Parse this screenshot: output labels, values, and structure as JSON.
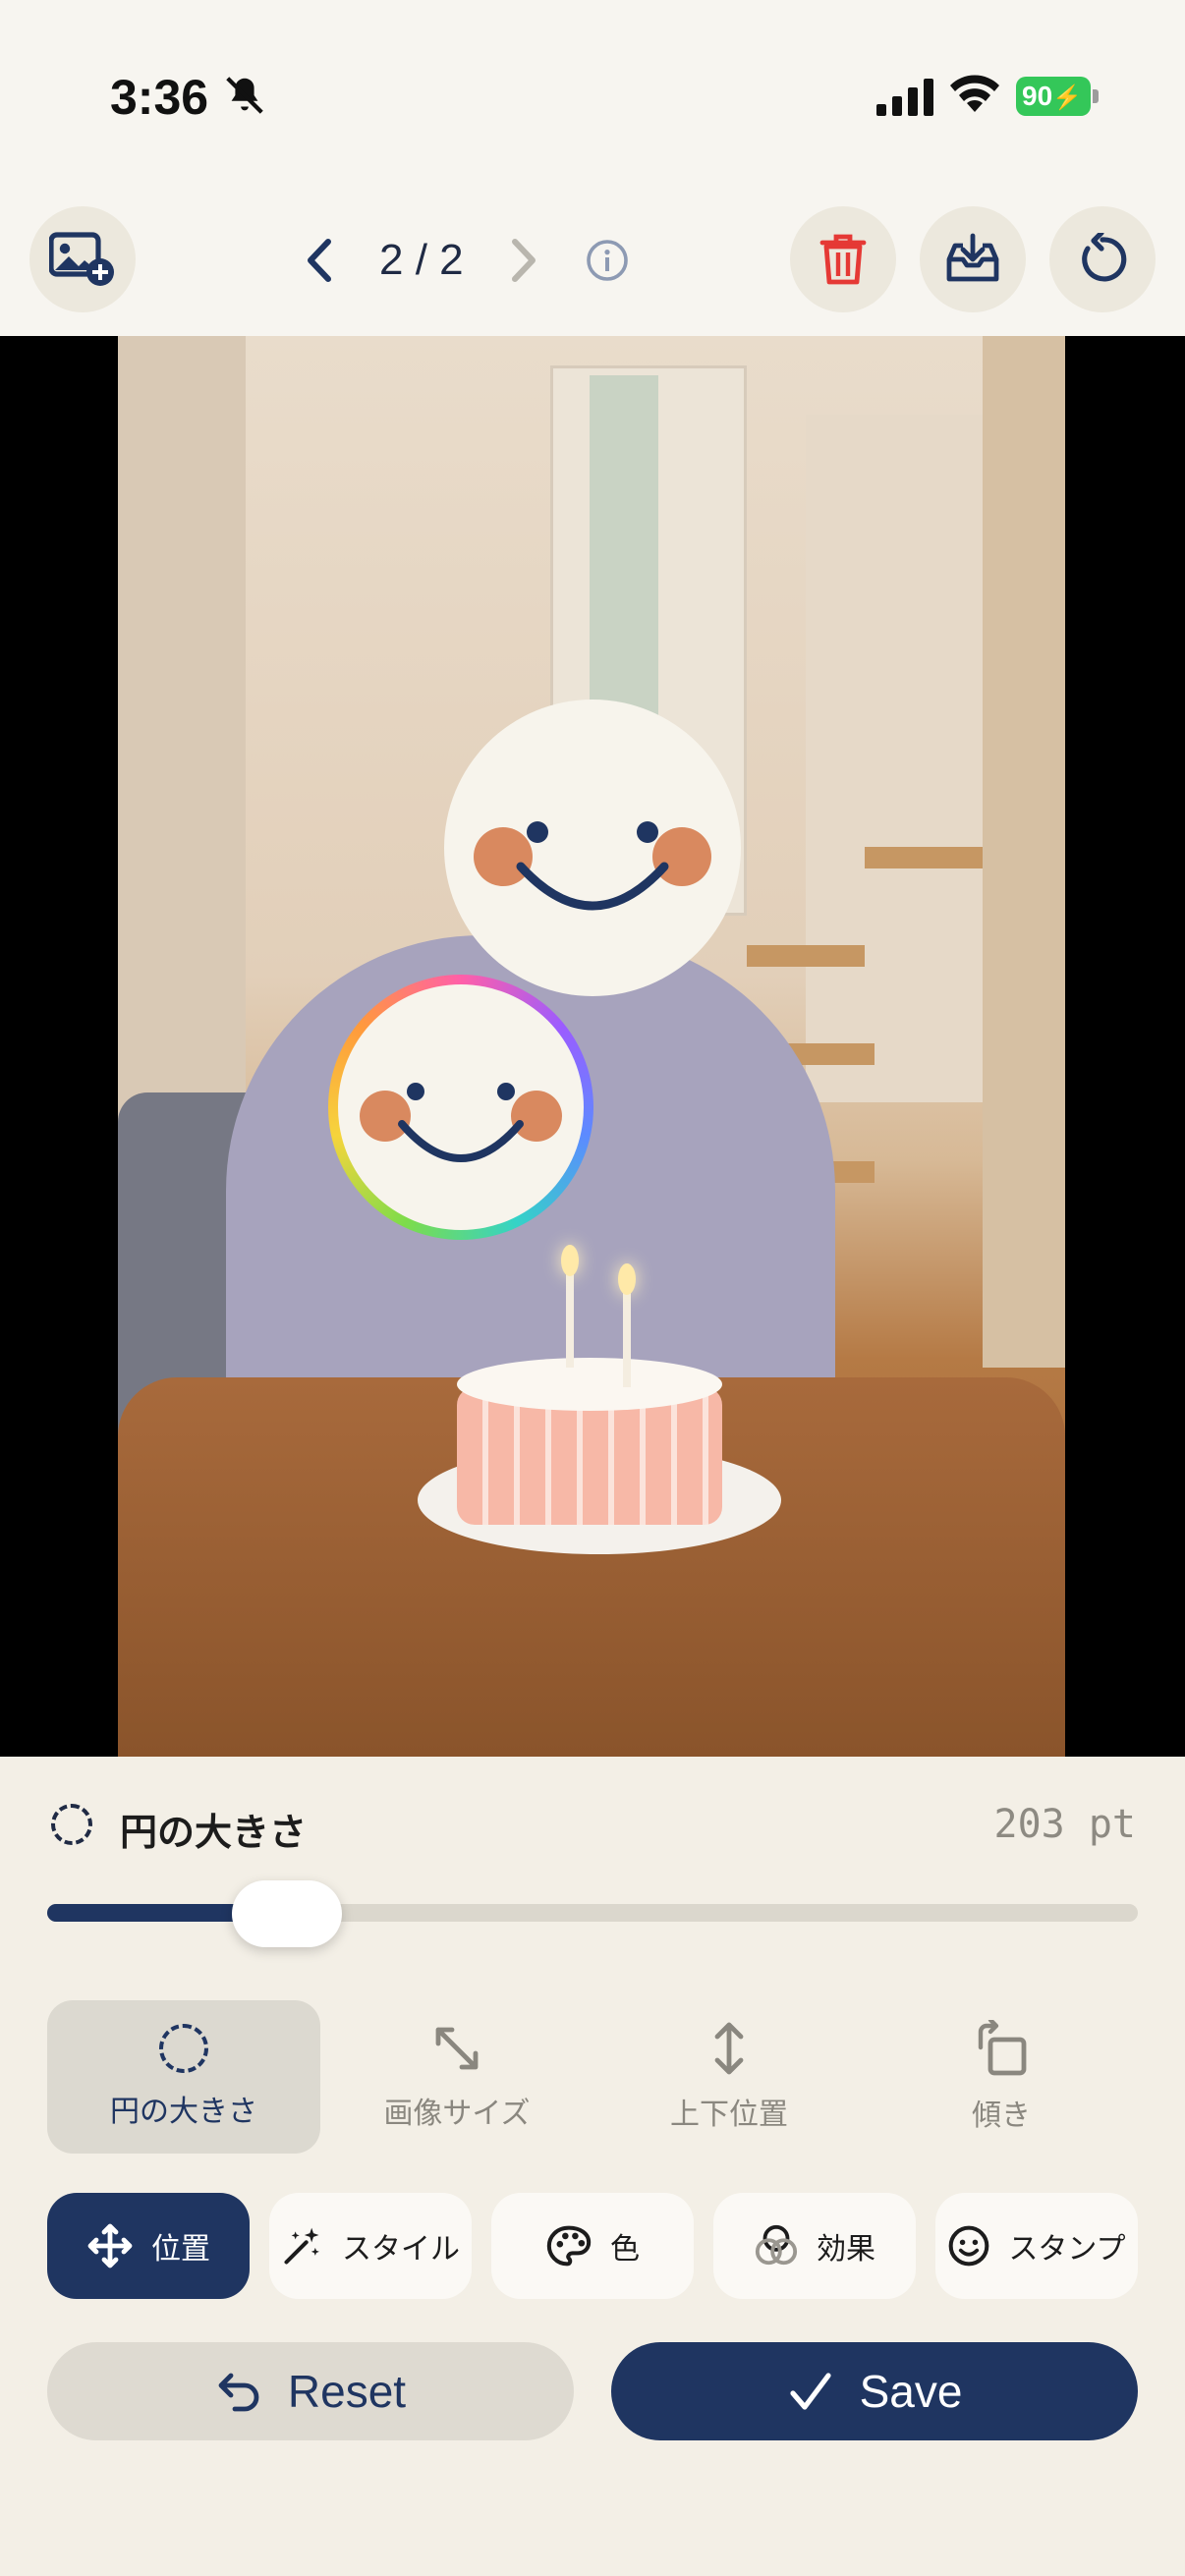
{
  "status_bar": {
    "time": "3:36",
    "battery": "90"
  },
  "toolbar": {
    "pager": "2 / 2"
  },
  "icons": {
    "add_photo": "add-photo-icon",
    "prev": "chevron-left-icon",
    "next": "chevron-right-icon",
    "info": "info-icon",
    "delete": "trash-icon",
    "download": "download-tray-icon",
    "rotate": "rotate-icon"
  },
  "slider": {
    "label": "円の大きさ",
    "value": "203 pt",
    "level": 0.22
  },
  "tool_tabs": [
    {
      "label": "円の大きさ",
      "icon": "dashed-circle-icon",
      "active": true
    },
    {
      "label": "画像サイズ",
      "icon": "resize-arrows-icon",
      "active": false
    },
    {
      "label": "上下位置",
      "icon": "vertical-arrows-icon",
      "active": false
    },
    {
      "label": "傾き",
      "icon": "tilt-icon",
      "active": false
    }
  ],
  "modes": [
    {
      "label": "位置",
      "icon": "move-icon",
      "active": true
    },
    {
      "label": "スタイル",
      "icon": "magic-wand-icon",
      "active": false
    },
    {
      "label": "色",
      "icon": "palette-icon",
      "active": false
    },
    {
      "label": "効果",
      "icon": "effects-icon",
      "active": false
    },
    {
      "label": "スタンプ",
      "icon": "smiley-icon",
      "active": false
    }
  ],
  "actions": {
    "reset_label": "Reset",
    "save_label": "Save"
  },
  "colors": {
    "accent": "#1f3561",
    "delete": "#e53935",
    "battery": "#34c759",
    "cheek": "#d9895f",
    "face": "#f7f4ec"
  }
}
